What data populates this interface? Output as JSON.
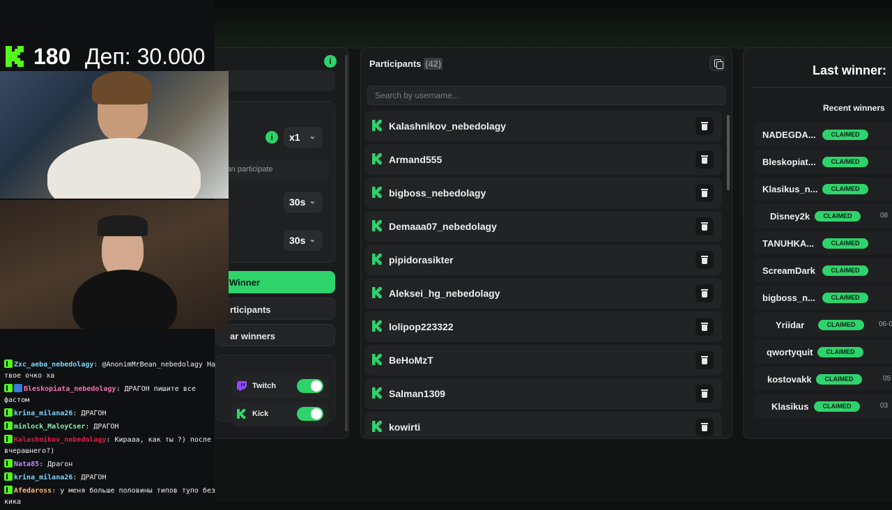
{
  "settings": {
    "multiplier": "x1",
    "participate_hint": "can participate",
    "timer1": "30s",
    "timer2": "30s",
    "winner_button": "Winner",
    "participants_button": "rticipants",
    "clear_button": "ar winners",
    "platforms": [
      {
        "label": "Twitch",
        "enabled": true
      },
      {
        "label": "Kick",
        "enabled": true
      }
    ]
  },
  "participants": {
    "title": "Participants",
    "count": "(42)",
    "search_placeholder": "Search by username...",
    "items": [
      {
        "name": "Kalashnikov_nebedolagy"
      },
      {
        "name": "Armand555"
      },
      {
        "name": "bigboss_nebedolagy"
      },
      {
        "name": "Demaaa07_nebedolagy"
      },
      {
        "name": "pipidorasikter"
      },
      {
        "name": "Aleksei_hg_nebedolagy"
      },
      {
        "name": "lolipop223322"
      },
      {
        "name": "BeHoMzT"
      },
      {
        "name": "Salman1309"
      },
      {
        "name": "kowirti"
      }
    ]
  },
  "winners": {
    "last_winner_label": "Last winner:",
    "recent_label": "Recent winners",
    "items": [
      {
        "name": "NADEGDA...",
        "status": "CLAIMED",
        "date": ""
      },
      {
        "name": "Bleskopiat...",
        "status": "CLAIMED",
        "date": ""
      },
      {
        "name": "Klasikus_n...",
        "status": "CLAIMED",
        "date": ""
      },
      {
        "name": "Disney2k",
        "status": "CLAIMED",
        "date": "08"
      },
      {
        "name": "TANUHKA...",
        "status": "CLAIMED",
        "date": ""
      },
      {
        "name": "ScreamDark",
        "status": "CLAIMED",
        "date": ""
      },
      {
        "name": "bigboss_n...",
        "status": "CLAIMED",
        "date": ""
      },
      {
        "name": "Yriidar",
        "status": "CLAIMED",
        "date": "06-0"
      },
      {
        "name": "qwortyquit",
        "status": "CLAIMED",
        "date": ""
      },
      {
        "name": "kostovakk",
        "status": "CLAIMED",
        "date": "05"
      },
      {
        "name": "Klasikus",
        "status": "CLAIMED",
        "date": "03"
      }
    ]
  },
  "stream": {
    "count": "180",
    "deposit": "Деп: 30.000",
    "colors": {
      "kick_green": "#53fc18",
      "accent": "#2ed36c"
    },
    "chat": [
      {
        "user": "Zxc_aeba_nebedolagy",
        "color": "#7dd3fc",
        "text": ": @AnonimMrBean_nebedolagy На твое очко ха"
      },
      {
        "user": "Bleskopiata_nebedolagy",
        "color": "#f472b6",
        "text": ": ДРАГОН пишите все фастом"
      },
      {
        "user": "krina_milana26",
        "color": "#7dd3fc",
        "text": ": ДРАГОН"
      },
      {
        "user": "minlock_MaloyCser",
        "color": "#86efac",
        "text": ": ДРАГОН"
      },
      {
        "user": "Kalashnikov_nebedolagy",
        "color": "#e11d48",
        "text": ": Кирааа, как ты ?) после вчерашнего?)"
      },
      {
        "user": "Nata85",
        "color": "#c084fc",
        "text": ": Драгон"
      },
      {
        "user": "krina_milana26",
        "color": "#7dd3fc",
        "text": ": ДРАГОН"
      },
      {
        "user": "Afedaross",
        "color": "#fdba74",
        "text": ": у меня больше половины типов тупо без кика"
      }
    ]
  }
}
